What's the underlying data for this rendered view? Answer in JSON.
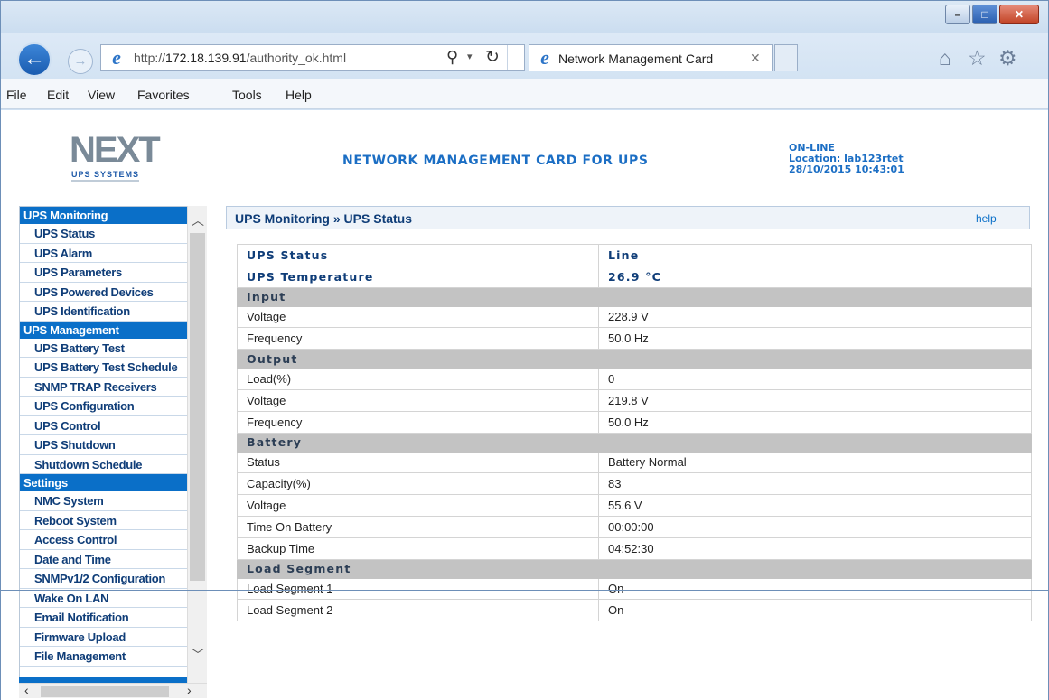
{
  "browser": {
    "url_prefix": "http://",
    "url_host": "172.18.139.91",
    "url_path": "/authority_ok.html",
    "tab_title": "Network Management Card",
    "menu": [
      "File",
      "Edit",
      "View",
      "Favorites",
      "Tools",
      "Help"
    ]
  },
  "header": {
    "logo_big": "NEXT",
    "logo_small": "UPS SYSTEMS",
    "title": "NETWORK MANAGEMENT CARD FOR UPS",
    "status": "ON-LINE",
    "location": "Location: lab123rtet",
    "datetime": "28/10/2015 10:43:01"
  },
  "sidebar": {
    "groups": [
      {
        "label": "UPS Monitoring",
        "items": [
          "UPS Status",
          "UPS Alarm",
          "UPS Parameters",
          "UPS Powered Devices",
          "UPS Identification"
        ]
      },
      {
        "label": "UPS Management",
        "items": [
          "UPS Battery Test",
          "UPS Battery Test Schedule",
          "SNMP TRAP Receivers",
          "UPS Configuration",
          "UPS Control",
          "UPS Shutdown",
          "Shutdown Schedule"
        ]
      },
      {
        "label": "Settings",
        "items": [
          "NMC System",
          "Reboot System",
          "Access Control",
          "Date and Time",
          "SNMPv1/2 Configuration",
          "Wake On LAN",
          "Email Notification",
          "Firmware Upload",
          "File Management"
        ]
      }
    ]
  },
  "main": {
    "breadcrumb": "UPS Monitoring » UPS Status",
    "help": "help",
    "rows": [
      {
        "type": "main",
        "label": "UPS Status",
        "value": "Line"
      },
      {
        "type": "main",
        "label": "UPS Temperature",
        "value": "26.9 °C"
      },
      {
        "type": "section",
        "label": "Input"
      },
      {
        "type": "row",
        "label": "Voltage",
        "value": "228.9 V"
      },
      {
        "type": "row",
        "label": "Frequency",
        "value": "50.0 Hz"
      },
      {
        "type": "section",
        "label": "Output"
      },
      {
        "type": "row",
        "label": "Load(%)",
        "value": "0"
      },
      {
        "type": "row",
        "label": "Voltage",
        "value": "219.8 V"
      },
      {
        "type": "row",
        "label": "Frequency",
        "value": "50.0 Hz"
      },
      {
        "type": "section",
        "label": "Battery"
      },
      {
        "type": "row",
        "label": "Status",
        "value": "Battery Normal"
      },
      {
        "type": "row",
        "label": "Capacity(%)",
        "value": "83"
      },
      {
        "type": "row",
        "label": "Voltage",
        "value": "55.6 V"
      },
      {
        "type": "row",
        "label": "Time On Battery",
        "value": "00:00:00"
      },
      {
        "type": "row",
        "label": "Backup Time",
        "value": "04:52:30"
      },
      {
        "type": "section",
        "label": "Load Segment"
      },
      {
        "type": "row",
        "label": "Load Segment 1",
        "value": "On"
      },
      {
        "type": "row",
        "label": "Load Segment 2",
        "value": "On"
      }
    ]
  }
}
